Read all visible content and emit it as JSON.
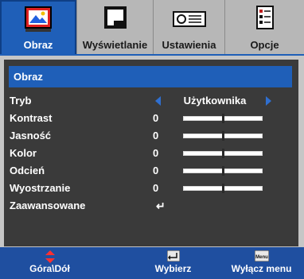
{
  "tabs": [
    {
      "label": "Obraz",
      "icon": "picture-icon",
      "active": true
    },
    {
      "label": "Wyświetlanie",
      "icon": "display-icon",
      "active": false
    },
    {
      "label": "Ustawienia",
      "icon": "projector-icon",
      "active": false
    },
    {
      "label": "Opcje",
      "icon": "options-icon",
      "active": false
    }
  ],
  "menu": {
    "title": "Obraz",
    "items": [
      {
        "label": "Tryb",
        "value": "Użytkownika",
        "type": "selector"
      },
      {
        "label": "Kontrast",
        "value": "0",
        "type": "slider",
        "level": 0.5
      },
      {
        "label": "Jasność",
        "value": "0",
        "type": "slider",
        "level": 0.5
      },
      {
        "label": "Kolor",
        "value": "0",
        "type": "slider",
        "level": 0.5
      },
      {
        "label": "Odcień",
        "value": "0",
        "type": "slider",
        "level": 0.5
      },
      {
        "label": "Wyostrzanie",
        "value": "0",
        "type": "slider",
        "level": 0.5
      },
      {
        "label": "Zaawansowane",
        "value": "↵",
        "type": "enter"
      }
    ]
  },
  "footer": {
    "updown": {
      "label": "Góra\\Dół",
      "icon": "up-down-arrows-icon"
    },
    "select": {
      "label": "Wybierz",
      "icon": "enter-key-icon"
    },
    "exit": {
      "label": "Wyłącz menu",
      "icon": "menu-key-icon",
      "key_text": "Menu"
    }
  },
  "colors": {
    "accent": "#1f5fb8",
    "panel": "#c6c6c6",
    "inner": "#3a3a3a",
    "footer": "#1f4fa0",
    "arrow": "#2f6fd0"
  }
}
